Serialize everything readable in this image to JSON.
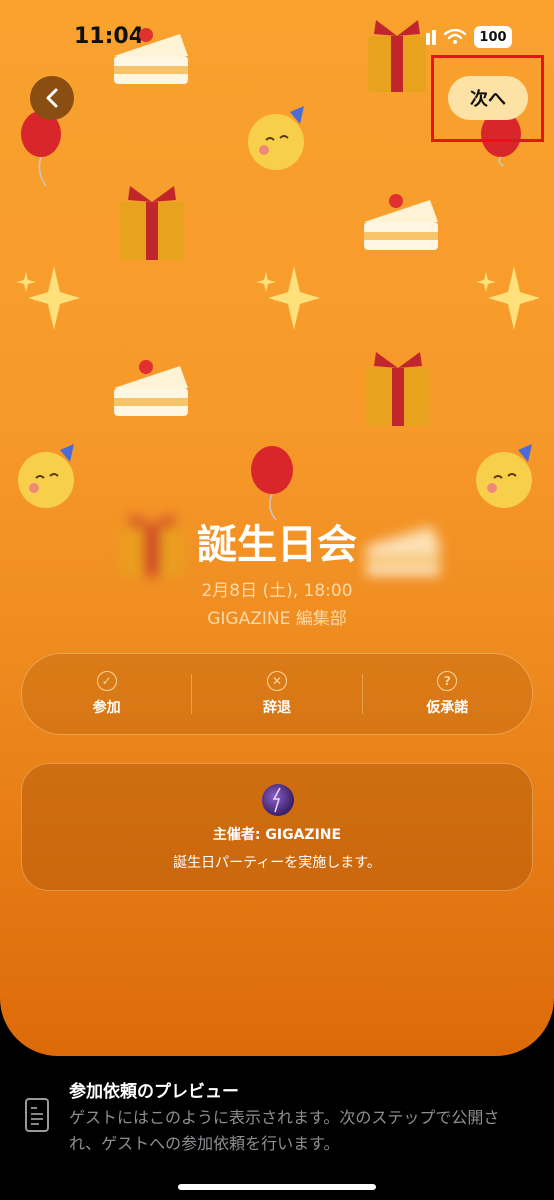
{
  "status_bar": {
    "time": "11:04",
    "battery": "100"
  },
  "header": {
    "back_icon": "chevron-left-icon",
    "next_label": "次へ"
  },
  "event": {
    "title": "誕生日会",
    "date": "2月8日 (土), 18:00",
    "organizer": "GIGAZINE 編集部"
  },
  "rsvp": [
    {
      "label": "参加",
      "icon": "check-circle-icon",
      "glyph": "✓"
    },
    {
      "label": "辞退",
      "icon": "x-circle-icon",
      "glyph": "✕"
    },
    {
      "label": "仮承諾",
      "icon": "question-circle-icon",
      "glyph": "?"
    }
  ],
  "host": {
    "name": "主催者: GIGAZINE",
    "description": "誕生日パーティーを実施します。"
  },
  "preview": {
    "title": "参加依頼のプレビュー",
    "description": "ゲストにはこのように表示されます。次のステップで公開され、ゲストへの参加依頼を行います。"
  },
  "colors": {
    "accent": "#fde2a6",
    "background_top": "#f9a22e",
    "background_bottom": "#dd6a08",
    "highlight": "#e8121b"
  }
}
